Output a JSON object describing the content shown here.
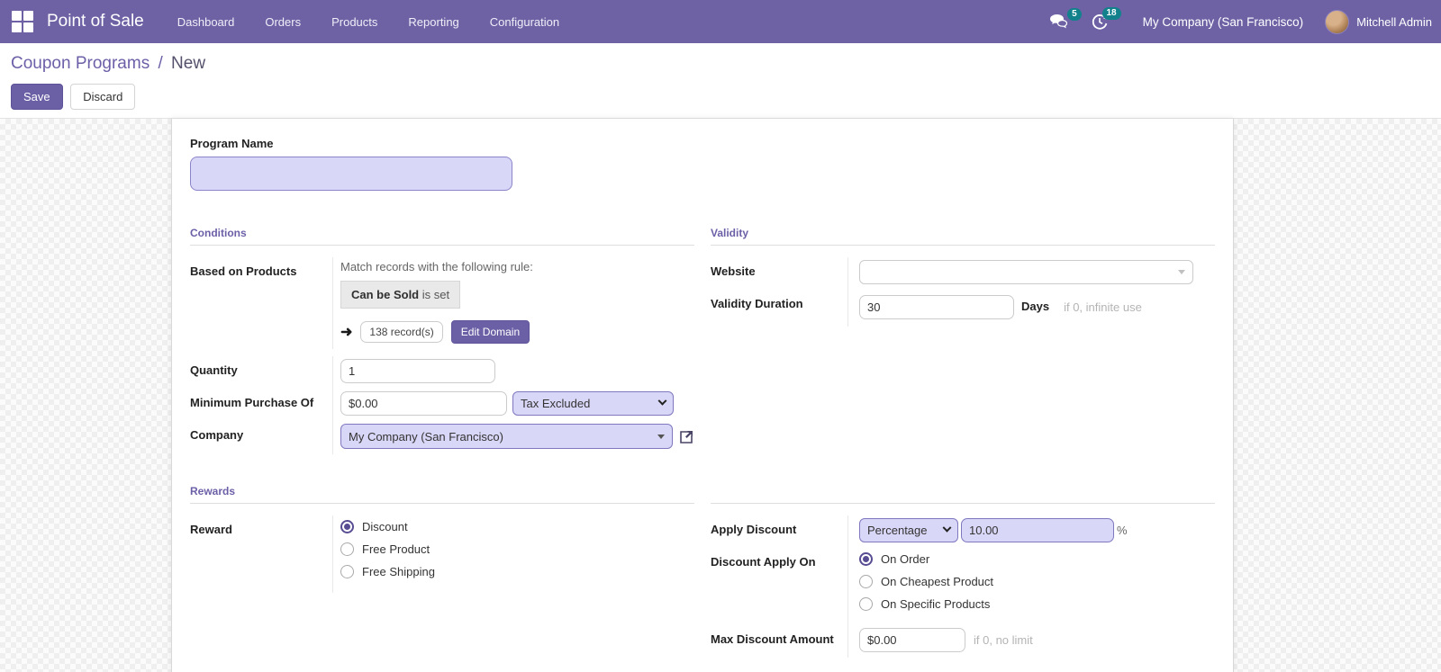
{
  "topbar": {
    "brand": "Point of Sale",
    "menus": [
      "Dashboard",
      "Orders",
      "Products",
      "Reporting",
      "Configuration"
    ],
    "messages_badge": "5",
    "activities_badge": "18",
    "company": "My Company (San Francisco)",
    "user": "Mitchell Admin"
  },
  "control_panel": {
    "breadcrumb_parent": "Coupon Programs",
    "breadcrumb_sep": "/",
    "breadcrumb_current": "New",
    "save_label": "Save",
    "discard_label": "Discard"
  },
  "form": {
    "program_name": {
      "label": "Program Name",
      "value": ""
    },
    "conditions": {
      "title": "Conditions",
      "based_on_products": {
        "label": "Based on Products",
        "intro": "Match records with the following rule:",
        "rule_field": "Can be Sold",
        "rule_operator": "is set",
        "arrow": "➜",
        "records_count": "138 record(s)",
        "edit_domain_label": "Edit Domain"
      },
      "quantity": {
        "label": "Quantity",
        "value": "1"
      },
      "min_purchase": {
        "label": "Minimum Purchase Of",
        "value": "$0.00",
        "tax_mode": "Tax Excluded"
      },
      "company": {
        "label": "Company",
        "value": "My Company (San Francisco)"
      }
    },
    "validity": {
      "title": "Validity",
      "website": {
        "label": "Website",
        "value": ""
      },
      "validity_duration": {
        "label": "Validity Duration",
        "value": "30",
        "unit": "Days",
        "hint": "if 0, infinite use"
      }
    },
    "rewards": {
      "title": "Rewards",
      "reward": {
        "label": "Reward",
        "options": [
          "Discount",
          "Free Product",
          "Free Shipping"
        ],
        "selected": "Discount"
      },
      "apply_discount": {
        "label": "Apply Discount",
        "mode": "Percentage",
        "value": "10.00",
        "suffix": "%"
      },
      "discount_apply_on": {
        "label": "Discount Apply On",
        "options": [
          "On Order",
          "On Cheapest Product",
          "On Specific Products"
        ],
        "selected": "On Order"
      },
      "max_discount": {
        "label": "Max Discount Amount",
        "value": "$0.00",
        "hint": "if 0, no limit"
      }
    }
  }
}
